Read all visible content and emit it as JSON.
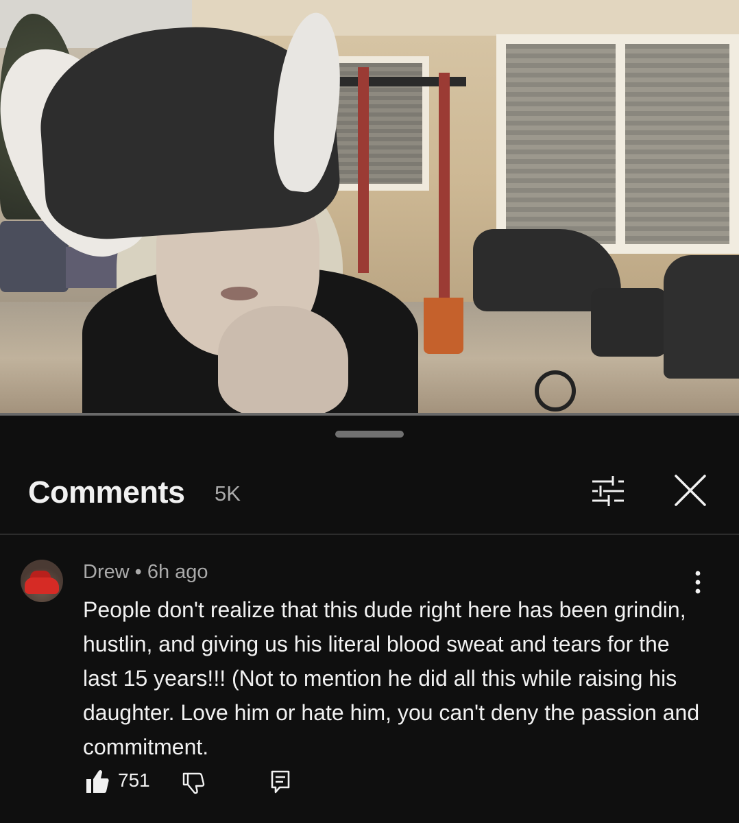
{
  "video": {
    "description_icon": "video-frame"
  },
  "comments_panel": {
    "title": "Comments",
    "count": "5K",
    "filter_icon": "sliders-icon",
    "close_icon": "close-icon"
  },
  "comment": {
    "author": "Drew",
    "separator": "•",
    "time": "6h ago",
    "text": "People don't realize that this dude right here has been grindin, hustlin, and giving us his literal blood sweat and tears for the last 15 years!!! (Not to mention he did all this while raising his daughter. Love him or hate him, you can't deny the passion and commitment.",
    "likes": "751",
    "more_icon": "more-vertical-icon",
    "like_icon": "thumbs-up-icon",
    "dislike_icon": "thumbs-down-icon",
    "reply_icon": "reply-icon"
  },
  "colors": {
    "background": "#0f0f0f",
    "text_primary": "#f1f1f1",
    "text_secondary": "#aaaaaa"
  }
}
